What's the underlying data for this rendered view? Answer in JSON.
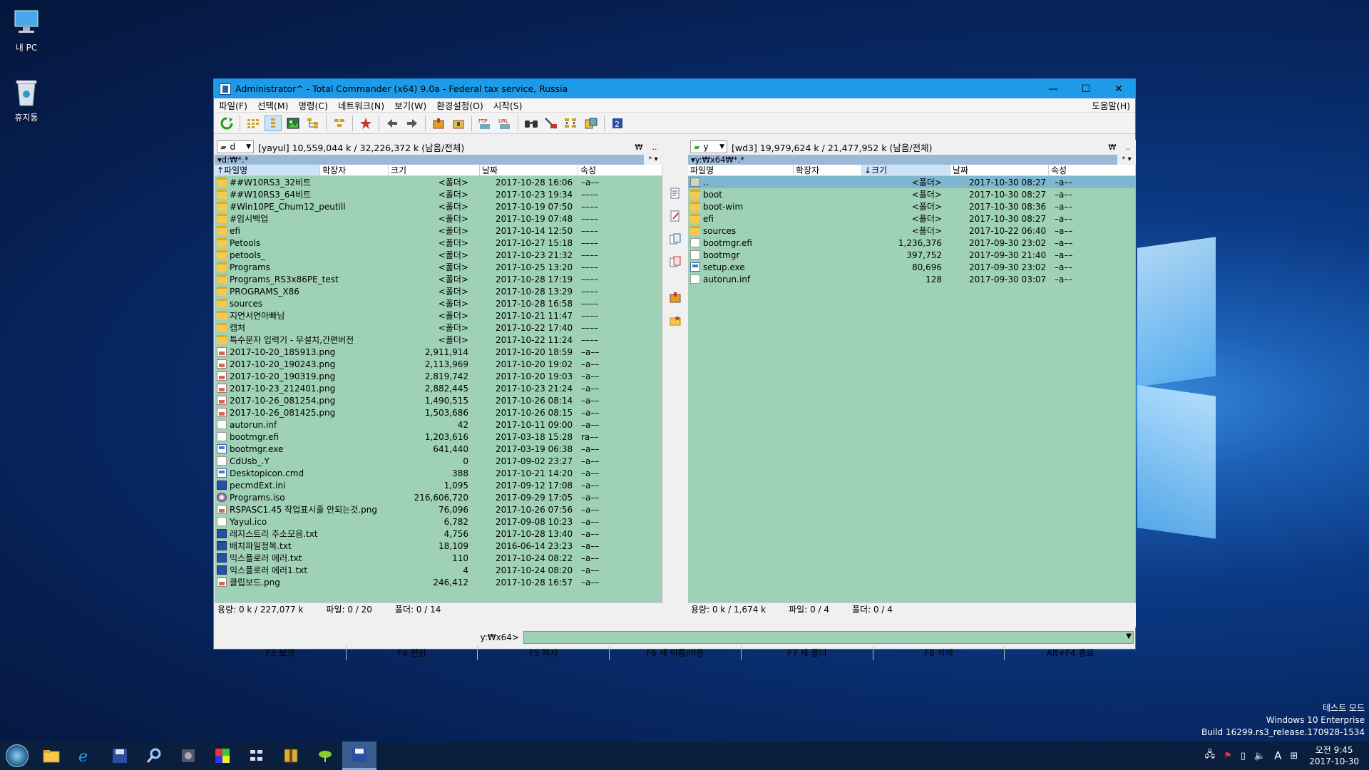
{
  "desktop": {
    "icons": [
      {
        "label": "내 PC"
      },
      {
        "label": "휴지통"
      }
    ],
    "watermark": [
      "테스트 모드",
      "Windows 10 Enterprise",
      "Build 16299.rs3_release.170928-1534"
    ]
  },
  "window": {
    "title": "Administrator^ - Total Commander (x64) 9.0a - Federal tax service, Russia",
    "controls": {
      "min": "—",
      "max": "☐",
      "close": "✕"
    }
  },
  "menu": {
    "items": [
      "파일(F)",
      "선택(M)",
      "명령(C)",
      "네트워크(N)",
      "보기(W)",
      "환경설정(O)",
      "시작(S)"
    ],
    "help": "도움말(H)"
  },
  "toolbar": {
    "icons": [
      "refresh-icon",
      "brief-view-icon",
      "tree-view-icon",
      "thumbnail-icon",
      "select-all-icon",
      "compare-dirs-icon",
      "new-file-icon",
      "back-icon",
      "forward-icon",
      "pack-icon",
      "unpack-icon",
      "ftp-icon",
      "url-icon",
      "find-icon",
      "rename-tool-icon",
      "sync-icon",
      "copy-names-icon",
      "editor-icon"
    ],
    "colors": {
      "ok": "#1a9a1a",
      "warn": "#d0a020",
      "red": "#c0392b",
      "blue": "#2a4fa0"
    }
  },
  "left": {
    "drive": "d",
    "drive_info": "[yayul]   10,559,044 k / 32,226,372 k (남음/전체)",
    "h1": "₩",
    "h2": "..",
    "path": "▾d:₩*.*",
    "star": "* ▾",
    "cols": [
      "↑파일명",
      "확장자",
      "크기",
      "날짜",
      "속성"
    ],
    "files": [
      {
        "name": "##W10RS3_32비트",
        "size": "<폴더>",
        "date": "2017-10-28 16:06",
        "attr": "–a––",
        "type": "folder"
      },
      {
        "name": "##W10RS3_64비트",
        "size": "<폴더>",
        "date": "2017-10-23 19:34",
        "attr": "––––",
        "type": "folder"
      },
      {
        "name": "#Win10PE_Chum12_peutill",
        "size": "<폴더>",
        "date": "2017-10-19 07:50",
        "attr": "––––",
        "type": "folder"
      },
      {
        "name": "#임시백업",
        "size": "<폴더>",
        "date": "2017-10-19 07:48",
        "attr": "––––",
        "type": "folder"
      },
      {
        "name": "efi",
        "size": "<폴더>",
        "date": "2017-10-14 12:50",
        "attr": "––––",
        "type": "folder"
      },
      {
        "name": "Petools",
        "size": "<폴더>",
        "date": "2017-10-27 15:18",
        "attr": "––––",
        "type": "folder"
      },
      {
        "name": "petools_",
        "size": "<폴더>",
        "date": "2017-10-23 21:32",
        "attr": "––––",
        "type": "folder"
      },
      {
        "name": "Programs",
        "size": "<폴더>",
        "date": "2017-10-25 13:20",
        "attr": "––––",
        "type": "folder"
      },
      {
        "name": "Programs_RS3x86PE_test",
        "size": "<폴더>",
        "date": "2017-10-28 17:19",
        "attr": "––––",
        "type": "folder"
      },
      {
        "name": "PROGRAMS_X86",
        "size": "<폴더>",
        "date": "2017-10-28 13:29",
        "attr": "––––",
        "type": "folder"
      },
      {
        "name": "sources",
        "size": "<폴더>",
        "date": "2017-10-28 16:58",
        "attr": "––––",
        "type": "folder"
      },
      {
        "name": "지연서연아빠님",
        "size": "<폴더>",
        "date": "2017-10-21 11:47",
        "attr": "––––",
        "type": "folder"
      },
      {
        "name": "캡처",
        "size": "<폴더>",
        "date": "2017-10-22 17:40",
        "attr": "––––",
        "type": "folder"
      },
      {
        "name": "특수문자 입력기 - 무설치,간편버전",
        "size": "<폴더>",
        "date": "2017-10-22 11:24",
        "attr": "––––",
        "type": "folder"
      },
      {
        "name": "2017-10-20_185913.png",
        "size": "2,911,914",
        "date": "2017-10-20 18:59",
        "attr": "–a––",
        "type": "image"
      },
      {
        "name": "2017-10-20_190243.png",
        "size": "2,113,969",
        "date": "2017-10-20 19:02",
        "attr": "–a––",
        "type": "image"
      },
      {
        "name": "2017-10-20_190319.png",
        "size": "2,819,742",
        "date": "2017-10-20 19:03",
        "attr": "–a––",
        "type": "image"
      },
      {
        "name": "2017-10-23_212401.png",
        "size": "2,882,445",
        "date": "2017-10-23 21:24",
        "attr": "–a––",
        "type": "image"
      },
      {
        "name": "2017-10-26_081254.png",
        "size": "1,490,515",
        "date": "2017-10-26 08:14",
        "attr": "–a––",
        "type": "image"
      },
      {
        "name": "2017-10-26_081425.png",
        "size": "1,503,686",
        "date": "2017-10-26 08:15",
        "attr": "–a––",
        "type": "image"
      },
      {
        "name": "autorun.inf",
        "size": "42",
        "date": "2017-10-11 09:00",
        "attr": "–a––",
        "type": "file"
      },
      {
        "name": "bootmgr.efi",
        "size": "1,203,616",
        "date": "2017-03-18 15:28",
        "attr": "ra––",
        "type": "file"
      },
      {
        "name": "bootmgr.exe",
        "size": "641,440",
        "date": "2017-03-19 06:38",
        "attr": "–a––",
        "type": "exe"
      },
      {
        "name": "CdUsb_.Y",
        "size": "0",
        "date": "2017-09-02 23:27",
        "attr": "–a––",
        "type": "file"
      },
      {
        "name": "Desktopicon.cmd",
        "size": "388",
        "date": "2017-10-21 14:20",
        "attr": "–a––",
        "type": "exe"
      },
      {
        "name": "pecmdExt.ini",
        "size": "1,095",
        "date": "2017-09-12 17:08",
        "attr": "–a––",
        "type": "blue"
      },
      {
        "name": "Programs.iso",
        "size": "216,606,720",
        "date": "2017-09-29 17:05",
        "attr": "–a––",
        "type": "iso"
      },
      {
        "name": "RSPASC1.45 작업표시줄 안되는것.png",
        "size": "76,096",
        "date": "2017-10-26 07:56",
        "attr": "–a––",
        "type": "image"
      },
      {
        "name": "Yayul.ico",
        "size": "6,782",
        "date": "2017-09-08 10:23",
        "attr": "–a––",
        "type": "file"
      },
      {
        "name": "레지스트리 주소모음.txt",
        "size": "4,756",
        "date": "2017-10-28 13:40",
        "attr": "–a––",
        "type": "blue"
      },
      {
        "name": "배치파일정복.txt",
        "size": "18,109",
        "date": "2016-06-14 23:23",
        "attr": "–a––",
        "type": "blue"
      },
      {
        "name": "익스플로러 에러.txt",
        "size": "110",
        "date": "2017-10-24 08:22",
        "attr": "–a––",
        "type": "blue"
      },
      {
        "name": "익스플로러 에러1.txt",
        "size": "4",
        "date": "2017-10-24 08:20",
        "attr": "–a––",
        "type": "blue"
      },
      {
        "name": "클립보드.png",
        "size": "246,412",
        "date": "2017-10-28 16:57",
        "attr": "–a––",
        "type": "image"
      }
    ],
    "status": {
      "cap": "용량: 0 k / 227,077 k",
      "files": "파일: 0 / 20",
      "folders": "폴더: 0 / 14"
    }
  },
  "right": {
    "drive": "y",
    "drive_info": "[wd3]   19,979,624 k / 21,477,952 k (남음/전체)",
    "h1": "₩",
    "h2": "..",
    "path": "▾y:₩x64₩*.*",
    "star": "* ▾",
    "cols": [
      "파일명",
      "확장자",
      "↓크기",
      "날짜",
      "속성"
    ],
    "files": [
      {
        "name": "..",
        "size": "<폴더>",
        "date": "2017-10-30 08:27",
        "attr": "–a––",
        "type": "up"
      },
      {
        "name": "boot",
        "size": "<폴더>",
        "date": "2017-10-30 08:27",
        "attr": "–a––",
        "type": "folder"
      },
      {
        "name": "boot-wim",
        "size": "<폴더>",
        "date": "2017-10-30 08:36",
        "attr": "–a––",
        "type": "folder"
      },
      {
        "name": "efi",
        "size": "<폴더>",
        "date": "2017-10-30 08:27",
        "attr": "–a––",
        "type": "folder"
      },
      {
        "name": "sources",
        "size": "<폴더>",
        "date": "2017-10-22 06:40",
        "attr": "–a––",
        "type": "folder"
      },
      {
        "name": "bootmgr.efi",
        "size": "1,236,376",
        "date": "2017-09-30 23:02",
        "attr": "–a––",
        "type": "file"
      },
      {
        "name": "bootmgr",
        "size": "397,752",
        "date": "2017-09-30 21:40",
        "attr": "–a––",
        "type": "file"
      },
      {
        "name": "setup.exe",
        "size": "80,696",
        "date": "2017-09-30 23:02",
        "attr": "–a––",
        "type": "exe"
      },
      {
        "name": "autorun.inf",
        "size": "128",
        "date": "2017-09-30 03:07",
        "attr": "–a––",
        "type": "file"
      }
    ],
    "status": {
      "cap": "용량: 0 k / 1,674 k",
      "files": "파일: 0 / 4",
      "folders": "폴더: 0 / 4"
    }
  },
  "cmd": {
    "label": "y:₩x64>",
    "value": ""
  },
  "fkeys": [
    "F3 보기",
    "F4 편집",
    "F5 복사",
    "F6 새 이름/이동",
    "F7 새 폴더",
    "F8 삭제",
    "Alt+F4 종료"
  ],
  "taskbar": {
    "items": [
      "file-explorer-icon",
      "internet-explorer-icon",
      "save-icon",
      "search-tool-icon",
      "app-icon",
      "color-icon",
      "grid-icon",
      "archive-icon",
      "leaf-icon",
      "total-commander-icon"
    ],
    "tray_icons": [
      "network-icon",
      "flag-icon",
      "usb-icon",
      "volume-icon",
      "ime-icon",
      "keyboard-icon"
    ],
    "ime": "A",
    "time": "오전 9:45",
    "date": "2017-10-30"
  }
}
